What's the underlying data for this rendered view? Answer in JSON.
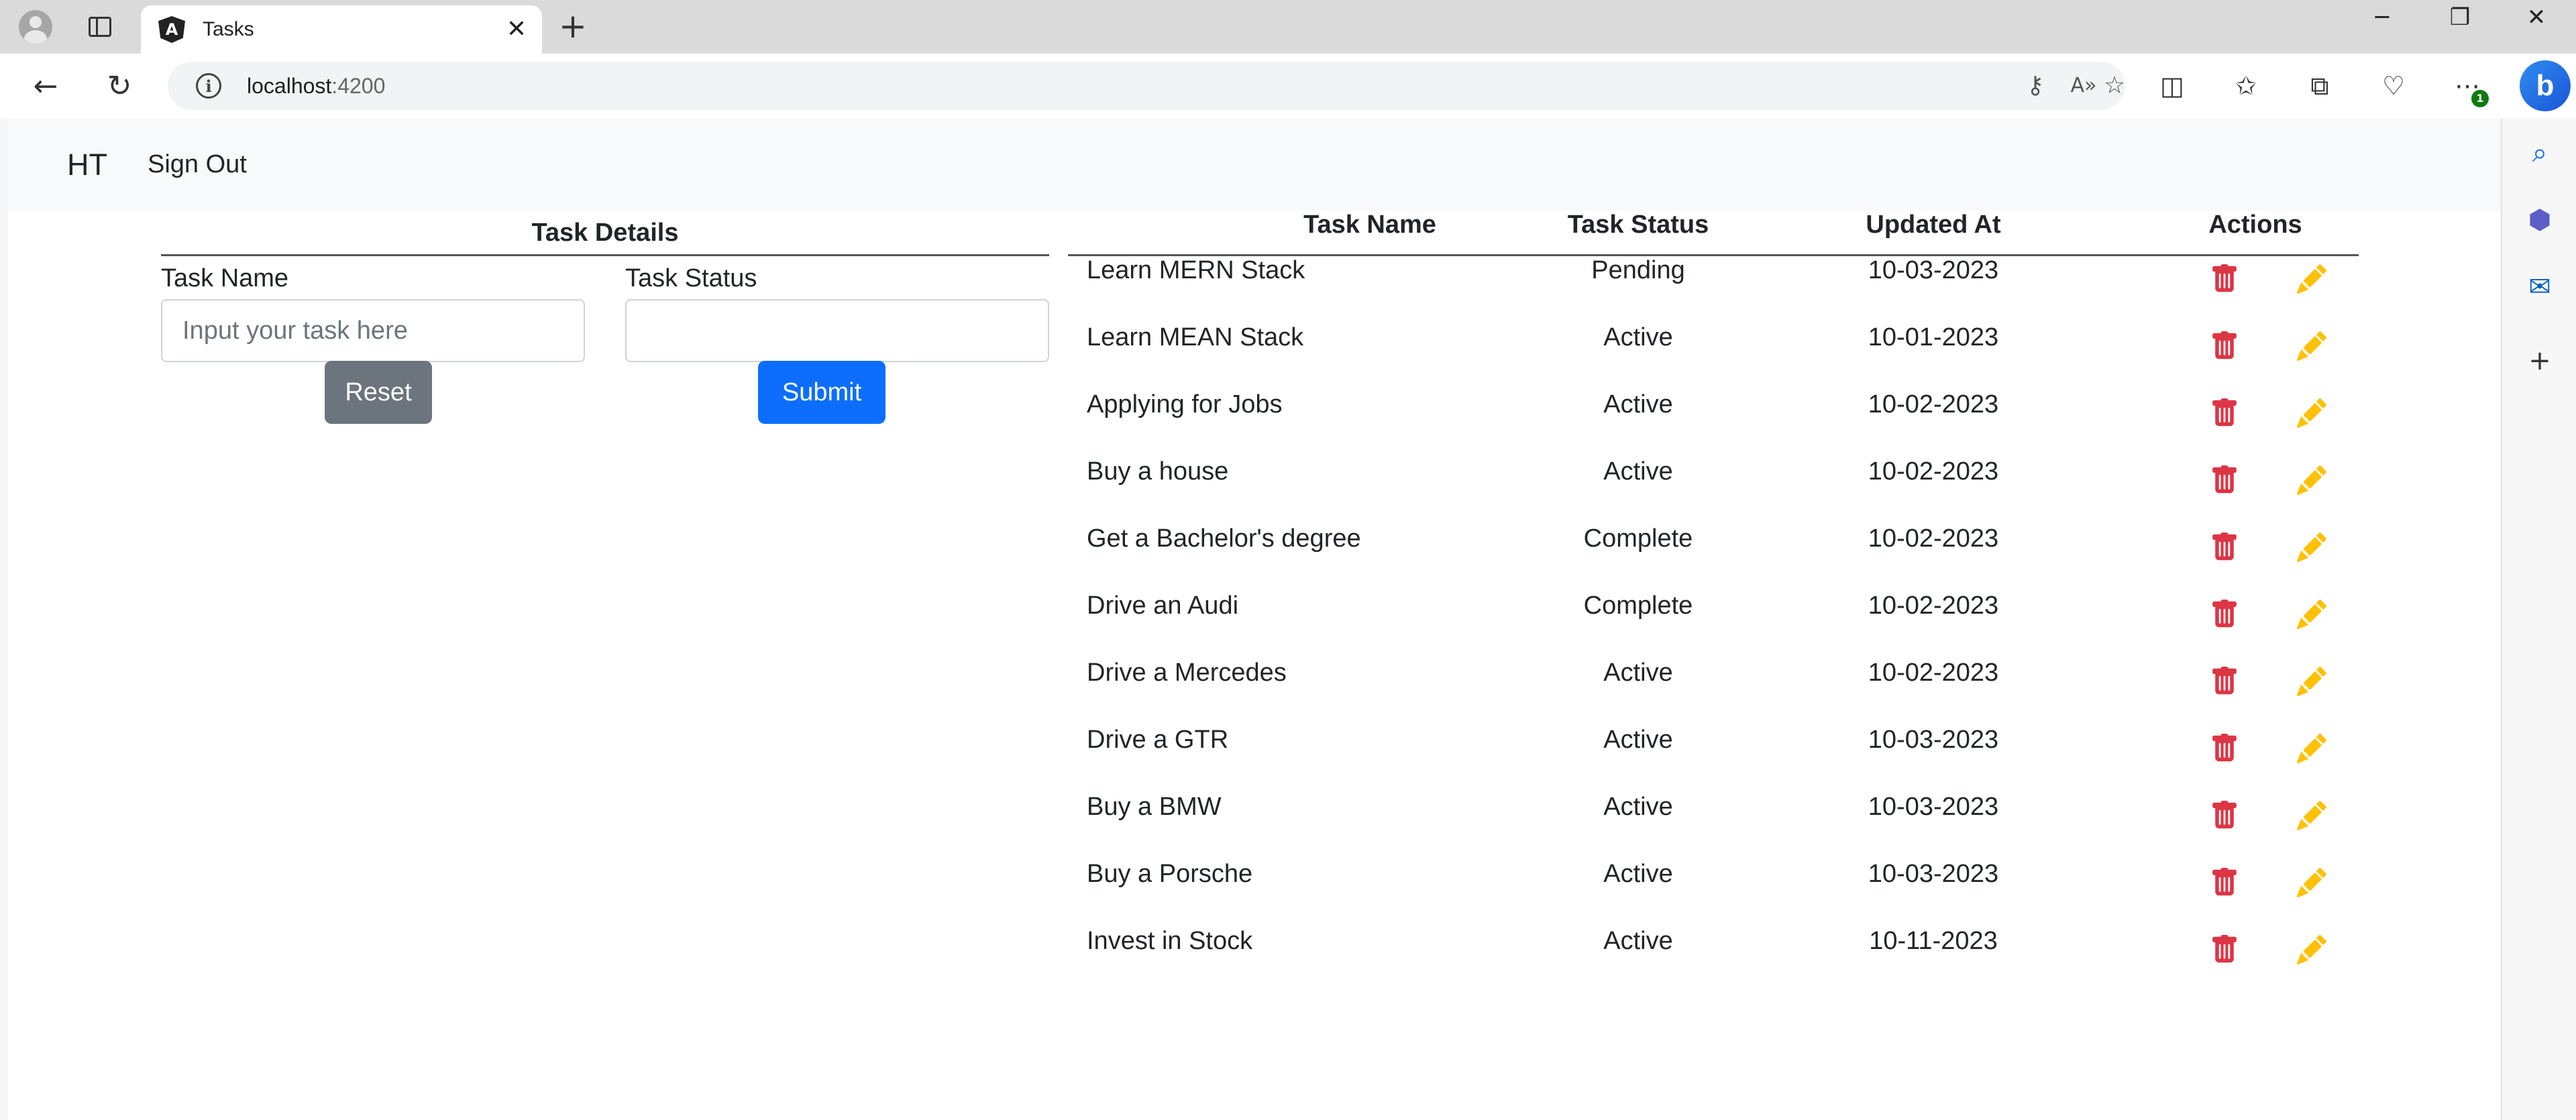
{
  "browser": {
    "tab_title": "Tasks",
    "tab_favicon": "A",
    "url_host": "localhost",
    "url_port": ":4200",
    "notification_count": "1",
    "bing_label": "b"
  },
  "app": {
    "brand": "HT",
    "sign_out": "Sign Out"
  },
  "form": {
    "header": "Task Details",
    "task_name_label": "Task Name",
    "task_name_placeholder": "Input your task here",
    "task_name_value": "",
    "task_status_label": "Task Status",
    "task_status_value": "",
    "reset_label": "Reset",
    "submit_label": "Submit"
  },
  "table": {
    "columns": [
      "Task Name",
      "Task Status",
      "Updated At",
      "Actions"
    ],
    "rows": [
      {
        "name": "Learn MERN Stack",
        "status": "Pending",
        "updated": "10-03-2023"
      },
      {
        "name": "Learn MEAN Stack",
        "status": "Active",
        "updated": "10-01-2023"
      },
      {
        "name": "Applying for Jobs",
        "status": "Active",
        "updated": "10-02-2023"
      },
      {
        "name": "Buy a house",
        "status": "Active",
        "updated": "10-02-2023"
      },
      {
        "name": "Get a Bachelor's degree",
        "status": "Complete",
        "updated": "10-02-2023"
      },
      {
        "name": "Drive an Audi",
        "status": "Complete",
        "updated": "10-02-2023"
      },
      {
        "name": "Drive a Mercedes",
        "status": "Active",
        "updated": "10-02-2023"
      },
      {
        "name": "Drive a GTR",
        "status": "Active",
        "updated": "10-03-2023"
      },
      {
        "name": "Buy a BMW",
        "status": "Active",
        "updated": "10-03-2023"
      },
      {
        "name": "Buy a Porsche",
        "status": "Active",
        "updated": "10-03-2023"
      },
      {
        "name": "Invest in Stock",
        "status": "Active",
        "updated": "10-11-2023"
      }
    ]
  },
  "colors": {
    "delete_icon": "#dc3545",
    "edit_icon": "#ffc107",
    "submit_button": "#0d6efd",
    "reset_button": "#6c757d"
  },
  "icons": {
    "row_actions": [
      "trash-icon",
      "pencil-icon"
    ]
  }
}
